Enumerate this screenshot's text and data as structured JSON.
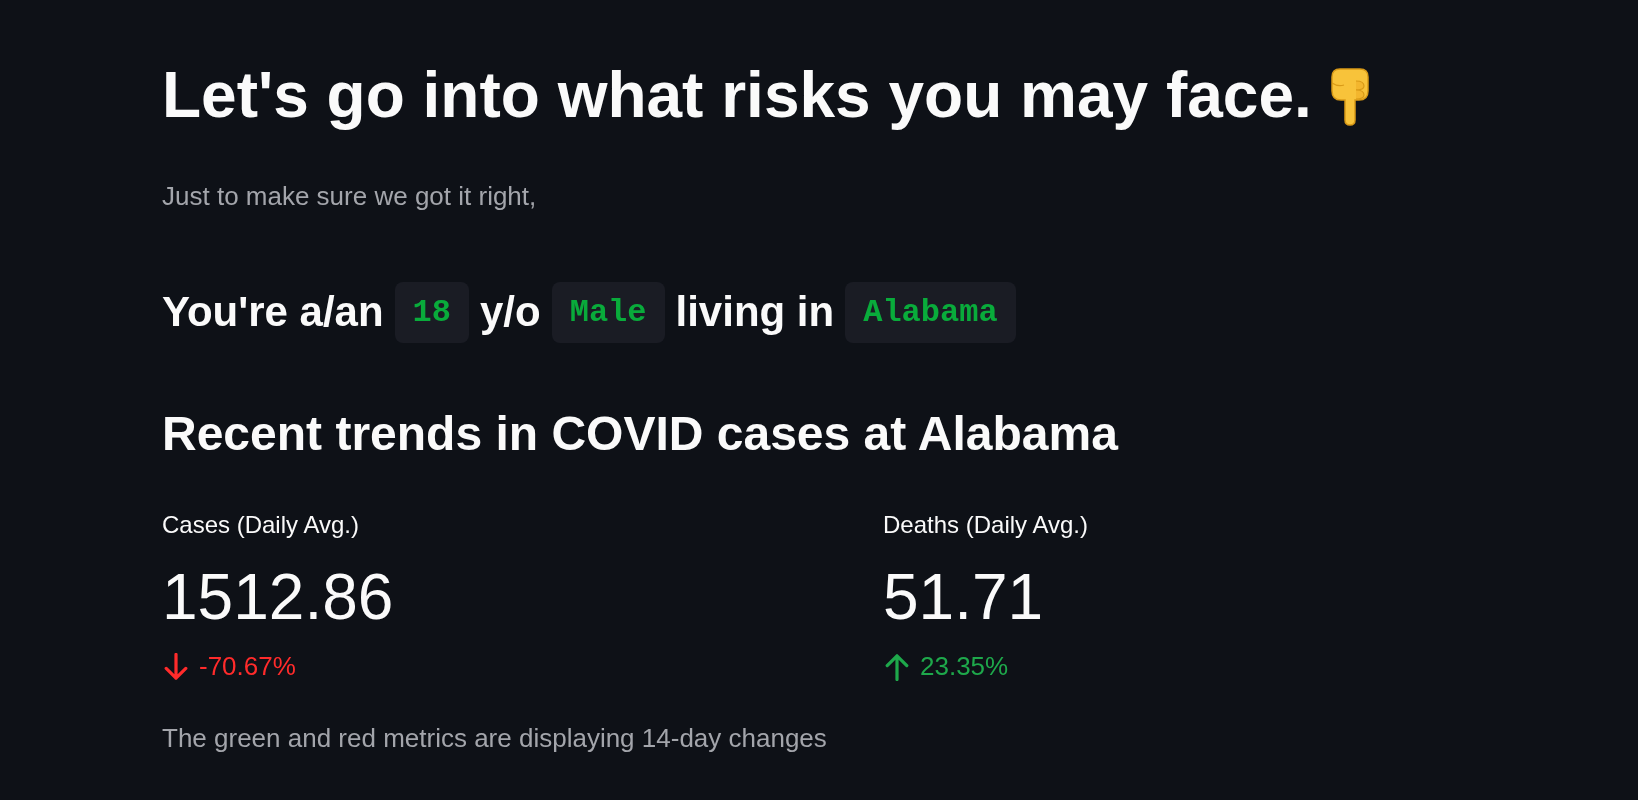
{
  "title": {
    "text": "Let's go into what risks you may face."
  },
  "intro": "Just to make sure we got it right,",
  "profile": {
    "parts": [
      {
        "kind": "text",
        "text": "You're a/an"
      },
      {
        "kind": "code",
        "text": "18"
      },
      {
        "kind": "text",
        "text": "y/o"
      },
      {
        "kind": "code",
        "text": "Male"
      },
      {
        "kind": "text",
        "text": "living in"
      },
      {
        "kind": "code",
        "text": "Alabama"
      }
    ]
  },
  "section_heading": "Recent trends in COVID cases at Alabama",
  "metrics": [
    {
      "label": "Cases (Daily Avg.)",
      "value": "1512.86",
      "delta": "-70.67%",
      "increased": false
    },
    {
      "label": "Deaths (Daily Avg.)",
      "value": "51.71",
      "delta": "23.35%",
      "increased": true
    }
  ],
  "footnote": "The green and red metrics are displaying 14-day changes"
}
